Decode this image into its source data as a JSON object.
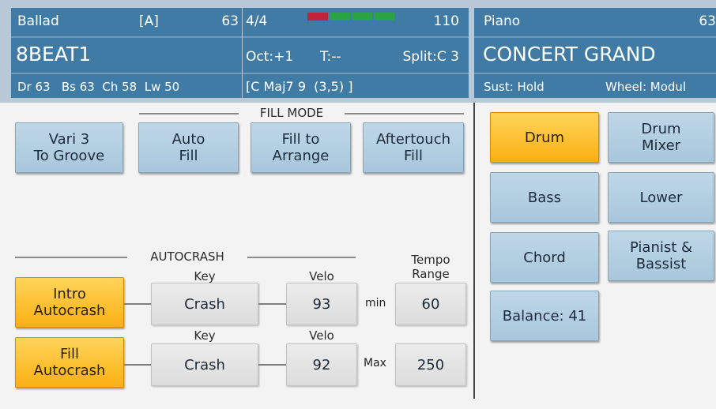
{
  "top_bar": {
    "style": {
      "name": "Ballad",
      "variation": "[A]",
      "volume": "63",
      "pattern": "8BEAT1",
      "volumes_line": "Dr 63   Bs 63  Ch 58  Lw 50"
    },
    "status": {
      "time_sig": "4/4",
      "tempo": "110",
      "octave": "Oct:+1",
      "transpose": "T:--",
      "split": "Split:C 3",
      "chord": "[C Maj7 9  (3,5) ]",
      "beat_leds": [
        "#c0243a",
        "#29a344",
        "#29a344",
        "#29a344"
      ]
    },
    "voice": {
      "category": "Piano",
      "volume": "63",
      "name": "CONCERT GRAND",
      "sustain": "Sust: Hold",
      "wheel": "Wheel: Modul"
    }
  },
  "fill_mode": {
    "title": "FILL MODE",
    "buttons": [
      {
        "label": "Vari 3\nTo Groove",
        "active": false
      },
      {
        "label": "Auto\nFill",
        "active": false
      },
      {
        "label": "Fill to\nArrange",
        "active": false
      },
      {
        "label": "Aftertouch\nFill",
        "active": false
      }
    ]
  },
  "autocrash": {
    "title": "AUTOCRASH",
    "key_label": "Key",
    "velo_label": "Velo",
    "tempo_range_label": "Tempo\nRange",
    "rows": [
      {
        "button": "Intro\nAutocrash",
        "active": true,
        "key": "Crash",
        "velo": "93",
        "range_label": "min",
        "range_value": "60"
      },
      {
        "button": "Fill\nAutocrash",
        "active": true,
        "key": "Crash",
        "velo": "92",
        "range_label": "Max",
        "range_value": "250"
      }
    ]
  },
  "mixer_panel": {
    "buttons": [
      {
        "label": "Drum",
        "active": true
      },
      {
        "label": "Drum\nMixer",
        "active": false
      },
      {
        "label": "Bass",
        "active": false
      },
      {
        "label": "Lower",
        "active": false
      },
      {
        "label": "Chord",
        "active": false
      },
      {
        "label": "Pianist &\nBassist",
        "active": false
      },
      {
        "label": "Balance: 41",
        "active": false
      }
    ]
  }
}
